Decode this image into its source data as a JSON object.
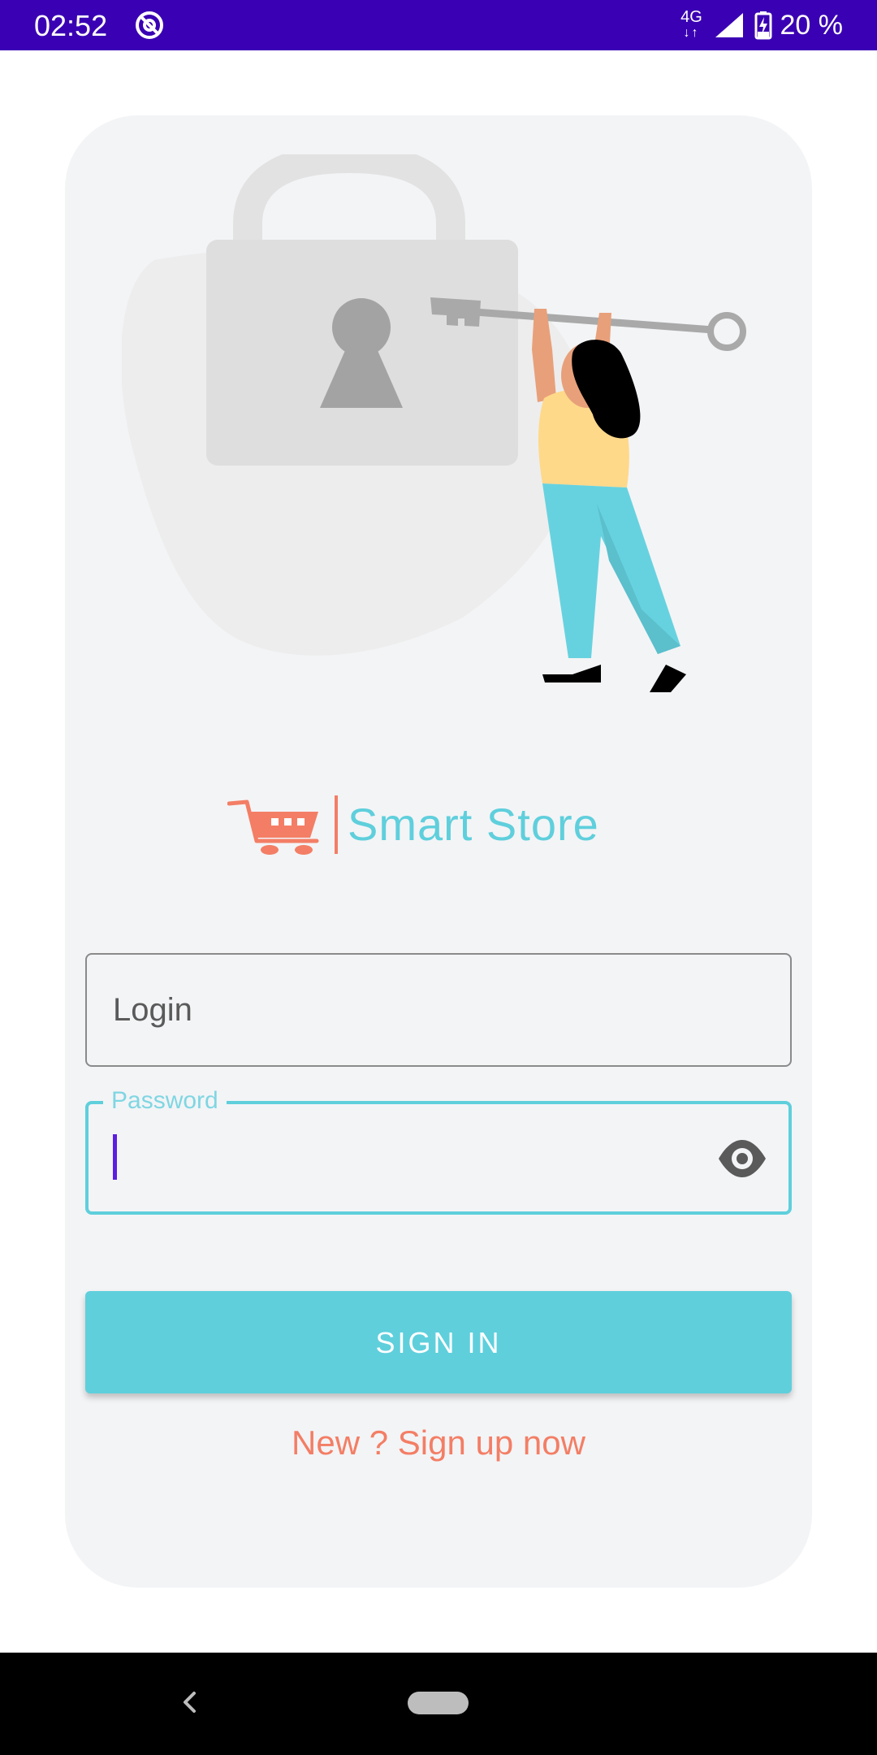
{
  "status_bar": {
    "time": "02:52",
    "network": "4G",
    "battery": "20 %",
    "app_icon": "at-sign-icon",
    "background": "#3a00b3"
  },
  "illustration": {
    "name": "lock-and-key-illustration",
    "colors": {
      "lock": "#dedede",
      "keyhole": "#a3a3a3",
      "key": "#a9a9a9",
      "blob": "#ededed",
      "shirt": "#ffd98a",
      "pants": "#67d2df",
      "skin": "#e8a07a",
      "hair": "#000000"
    }
  },
  "brand": {
    "name": "Smart Store",
    "icon": "shopping-cart-icon",
    "accent": "#f37e65",
    "text_color": "#5fcfdc"
  },
  "form": {
    "login": {
      "placeholder": "Login",
      "value": ""
    },
    "password": {
      "label": "Password",
      "value": "",
      "toggle_icon": "eye-icon"
    },
    "submit_label": "SIGN IN",
    "signup_link": "New ? Sign up now"
  },
  "colors": {
    "primary": "#5fcfdc",
    "link": "#f37e65",
    "card": "#f3f4f6",
    "cursor": "#5b1ee0"
  },
  "nav_bar": {
    "back_icon": "back-chevron-icon",
    "home_icon": "home-pill-icon"
  }
}
